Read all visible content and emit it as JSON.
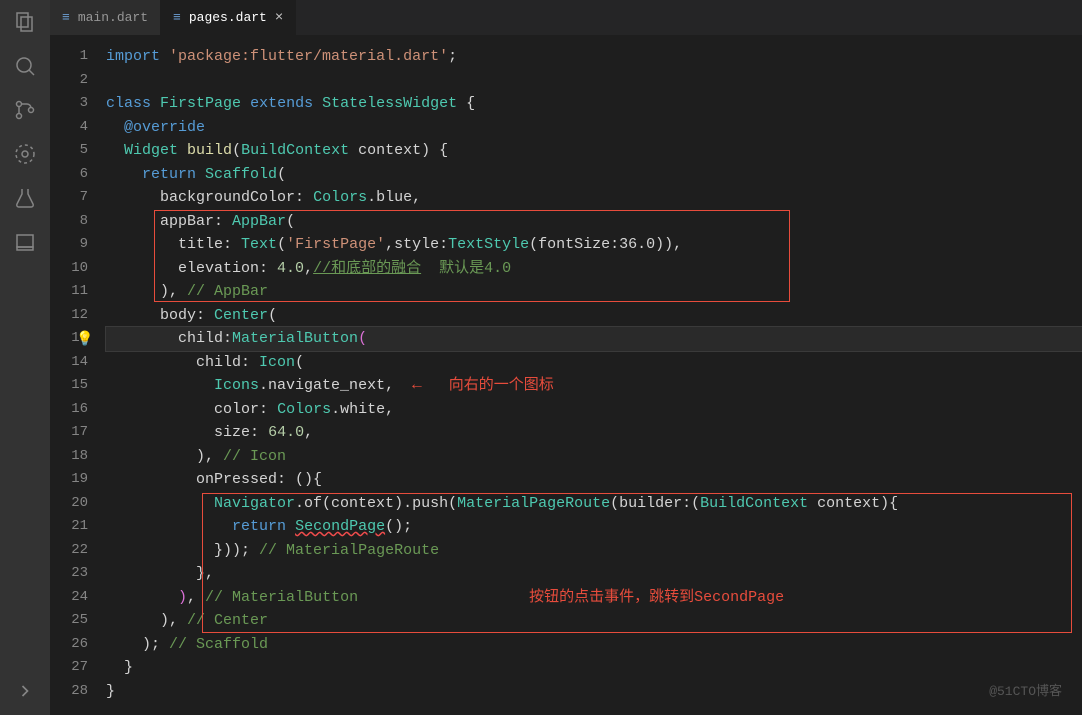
{
  "sidebar": {
    "icons": [
      "files-icon",
      "search-icon",
      "source-control-icon",
      "debug-icon",
      "extensions-icon",
      "testing-icon",
      "bookmark-icon"
    ]
  },
  "tabs": [
    {
      "label": "main.dart",
      "active": false
    },
    {
      "label": "pages.dart",
      "active": true
    }
  ],
  "gutter": {
    "start": 1,
    "end": 28
  },
  "watermark": "@51CTO博客",
  "code": {
    "l1": {
      "kw": "import",
      "str": "'package:flutter/material.dart'",
      "semi": ";"
    },
    "l3": {
      "kw1": "class",
      "name": "FirstPage",
      "kw2": "extends",
      "base": "StatelessWidget",
      "brace": " {"
    },
    "l4": {
      "ann": "@override"
    },
    "l5": {
      "type": "Widget",
      "fn": "build",
      "ptype": "BuildContext",
      "pname": "context",
      "tail": ") {"
    },
    "l6": {
      "kw": "return",
      "type": "Scaffold",
      "open": "("
    },
    "l7": {
      "prop": "backgroundColor:",
      "val": "Colors",
      "sub": ".blue,",
      "rest": ""
    },
    "l8": {
      "prop": "appBar:",
      "type": "AppBar",
      "open": "("
    },
    "l9": {
      "prop": "title:",
      "t1": "Text",
      "op": "(",
      "str": "'FirstPage'",
      "mid": ",style:",
      "t2": "TextStyle",
      "args": "(fontSize:36.0)),"
    },
    "l10": {
      "prop": "elevation:",
      "num": "4.0",
      "comma": ",",
      "commentLink": "//和底部的融合",
      "comment2": "  默认是4.0"
    },
    "l11": {
      "close": "),",
      "cmt": " // AppBar"
    },
    "l12": {
      "prop": "body:",
      "type": "Center",
      "open": "("
    },
    "l13": {
      "prop": "child:",
      "type": "MaterialButton",
      "open": "("
    },
    "l14": {
      "prop": "child:",
      "type": "Icon",
      "open": "("
    },
    "l15": {
      "val": "Icons",
      "sub": ".navigate_next,",
      "anno": "向右的一个图标"
    },
    "l16": {
      "prop": "color:",
      "val": "Colors",
      "sub": ".white,"
    },
    "l17": {
      "prop": "size:",
      "num": "64.0",
      "comma": ","
    },
    "l18": {
      "close": "),",
      "cmt": " // Icon"
    },
    "l19": {
      "prop": "onPressed:",
      "arrow": "(){",
      "rest": ""
    },
    "l20": {
      "nav": "Navigator",
      "call": ".of(context).push(",
      "type": "MaterialPageRoute",
      "args": "(builder:(",
      "ptype": "BuildContext",
      "tail": " context){"
    },
    "l21": {
      "kw": "return",
      "type": "SecondPage",
      "call": "();"
    },
    "l22": {
      "close": "}));",
      "cmt": " // MaterialPageRoute"
    },
    "l23": {
      "close": "},"
    },
    "l24": {
      "close": "),",
      "cmt": " // MaterialButton",
      "anno": "按钮的点击事件，跳转到SecondPage"
    },
    "l25": {
      "close": "),",
      "cmt": " // Center"
    },
    "l26": {
      "close": ");",
      "cmt": " // Scaffold"
    },
    "l27": {
      "close": "}"
    },
    "l28": {
      "close": "}"
    }
  }
}
